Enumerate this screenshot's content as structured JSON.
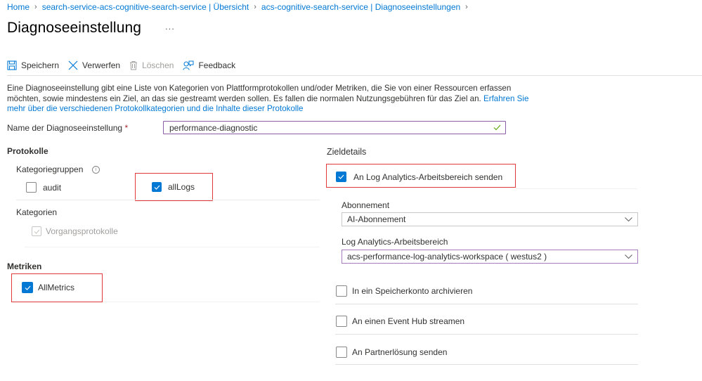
{
  "breadcrumb": [
    {
      "label": "Home"
    },
    {
      "label": "search-service-acs-cognitive-search-service | Übersicht"
    },
    {
      "label": "acs-cognitive-search-service | Diagnoseeinstellungen"
    }
  ],
  "page": {
    "title": "Diagnoseeinstellung",
    "more_label": "..."
  },
  "toolbar": {
    "save_label": "Speichern",
    "discard_label": "Verwerfen",
    "delete_label": "Löschen",
    "feedback_label": "Feedback"
  },
  "description": {
    "text": "Eine Diagnoseeinstellung gibt eine Liste von Kategorien von Plattformprotokollen und/oder Metriken, die Sie von einer Ressourcen erfassen möchten, sowie mindestens ein Ziel, an das sie gestreamt werden sollen. Es fallen die normalen Nutzungsgebühren für das Ziel an. ",
    "link": "Erfahren Sie mehr über die verschiedenen Protokollkategorien und die Inhalte dieser Protokolle"
  },
  "name_field": {
    "label": "Name der Diagnoseeinstellung",
    "required_mark": "*",
    "value": "performance-diagnostic",
    "valid_icon": "check-icon"
  },
  "logs": {
    "heading": "Protokolle",
    "category_groups_label": "Kategoriegruppen",
    "info_icon": "info-icon",
    "groups": [
      {
        "label": "audit",
        "checked": false
      },
      {
        "label": "allLogs",
        "checked": true
      }
    ],
    "categories_label": "Kategorien",
    "categories": [
      {
        "label": "Vorgangsprotokolle",
        "checked": true,
        "disabled": true
      }
    ]
  },
  "metrics": {
    "heading": "Metriken",
    "items": [
      {
        "label": "AllMetrics",
        "checked": true
      }
    ]
  },
  "destination": {
    "heading": "Zieldetails",
    "log_analytics": {
      "label": "An Log Analytics-Arbeitsbereich senden",
      "checked": true
    },
    "subscription": {
      "label": "Abonnement",
      "value": "AI-Abonnement"
    },
    "workspace": {
      "label": "Log Analytics-Arbeitsbereich",
      "value": "acs-performance-log-analytics-workspace ( westus2 )"
    },
    "others": [
      {
        "label": "In ein Speicherkonto archivieren",
        "checked": false
      },
      {
        "label": "An einen Event Hub streamen",
        "checked": false
      },
      {
        "label": "An Partnerlösung senden",
        "checked": false
      }
    ]
  },
  "colors": {
    "accent": "#0078d4",
    "highlight": "#e03a3a",
    "input_focus": "#8a5ea8",
    "valid": "#57a300"
  }
}
